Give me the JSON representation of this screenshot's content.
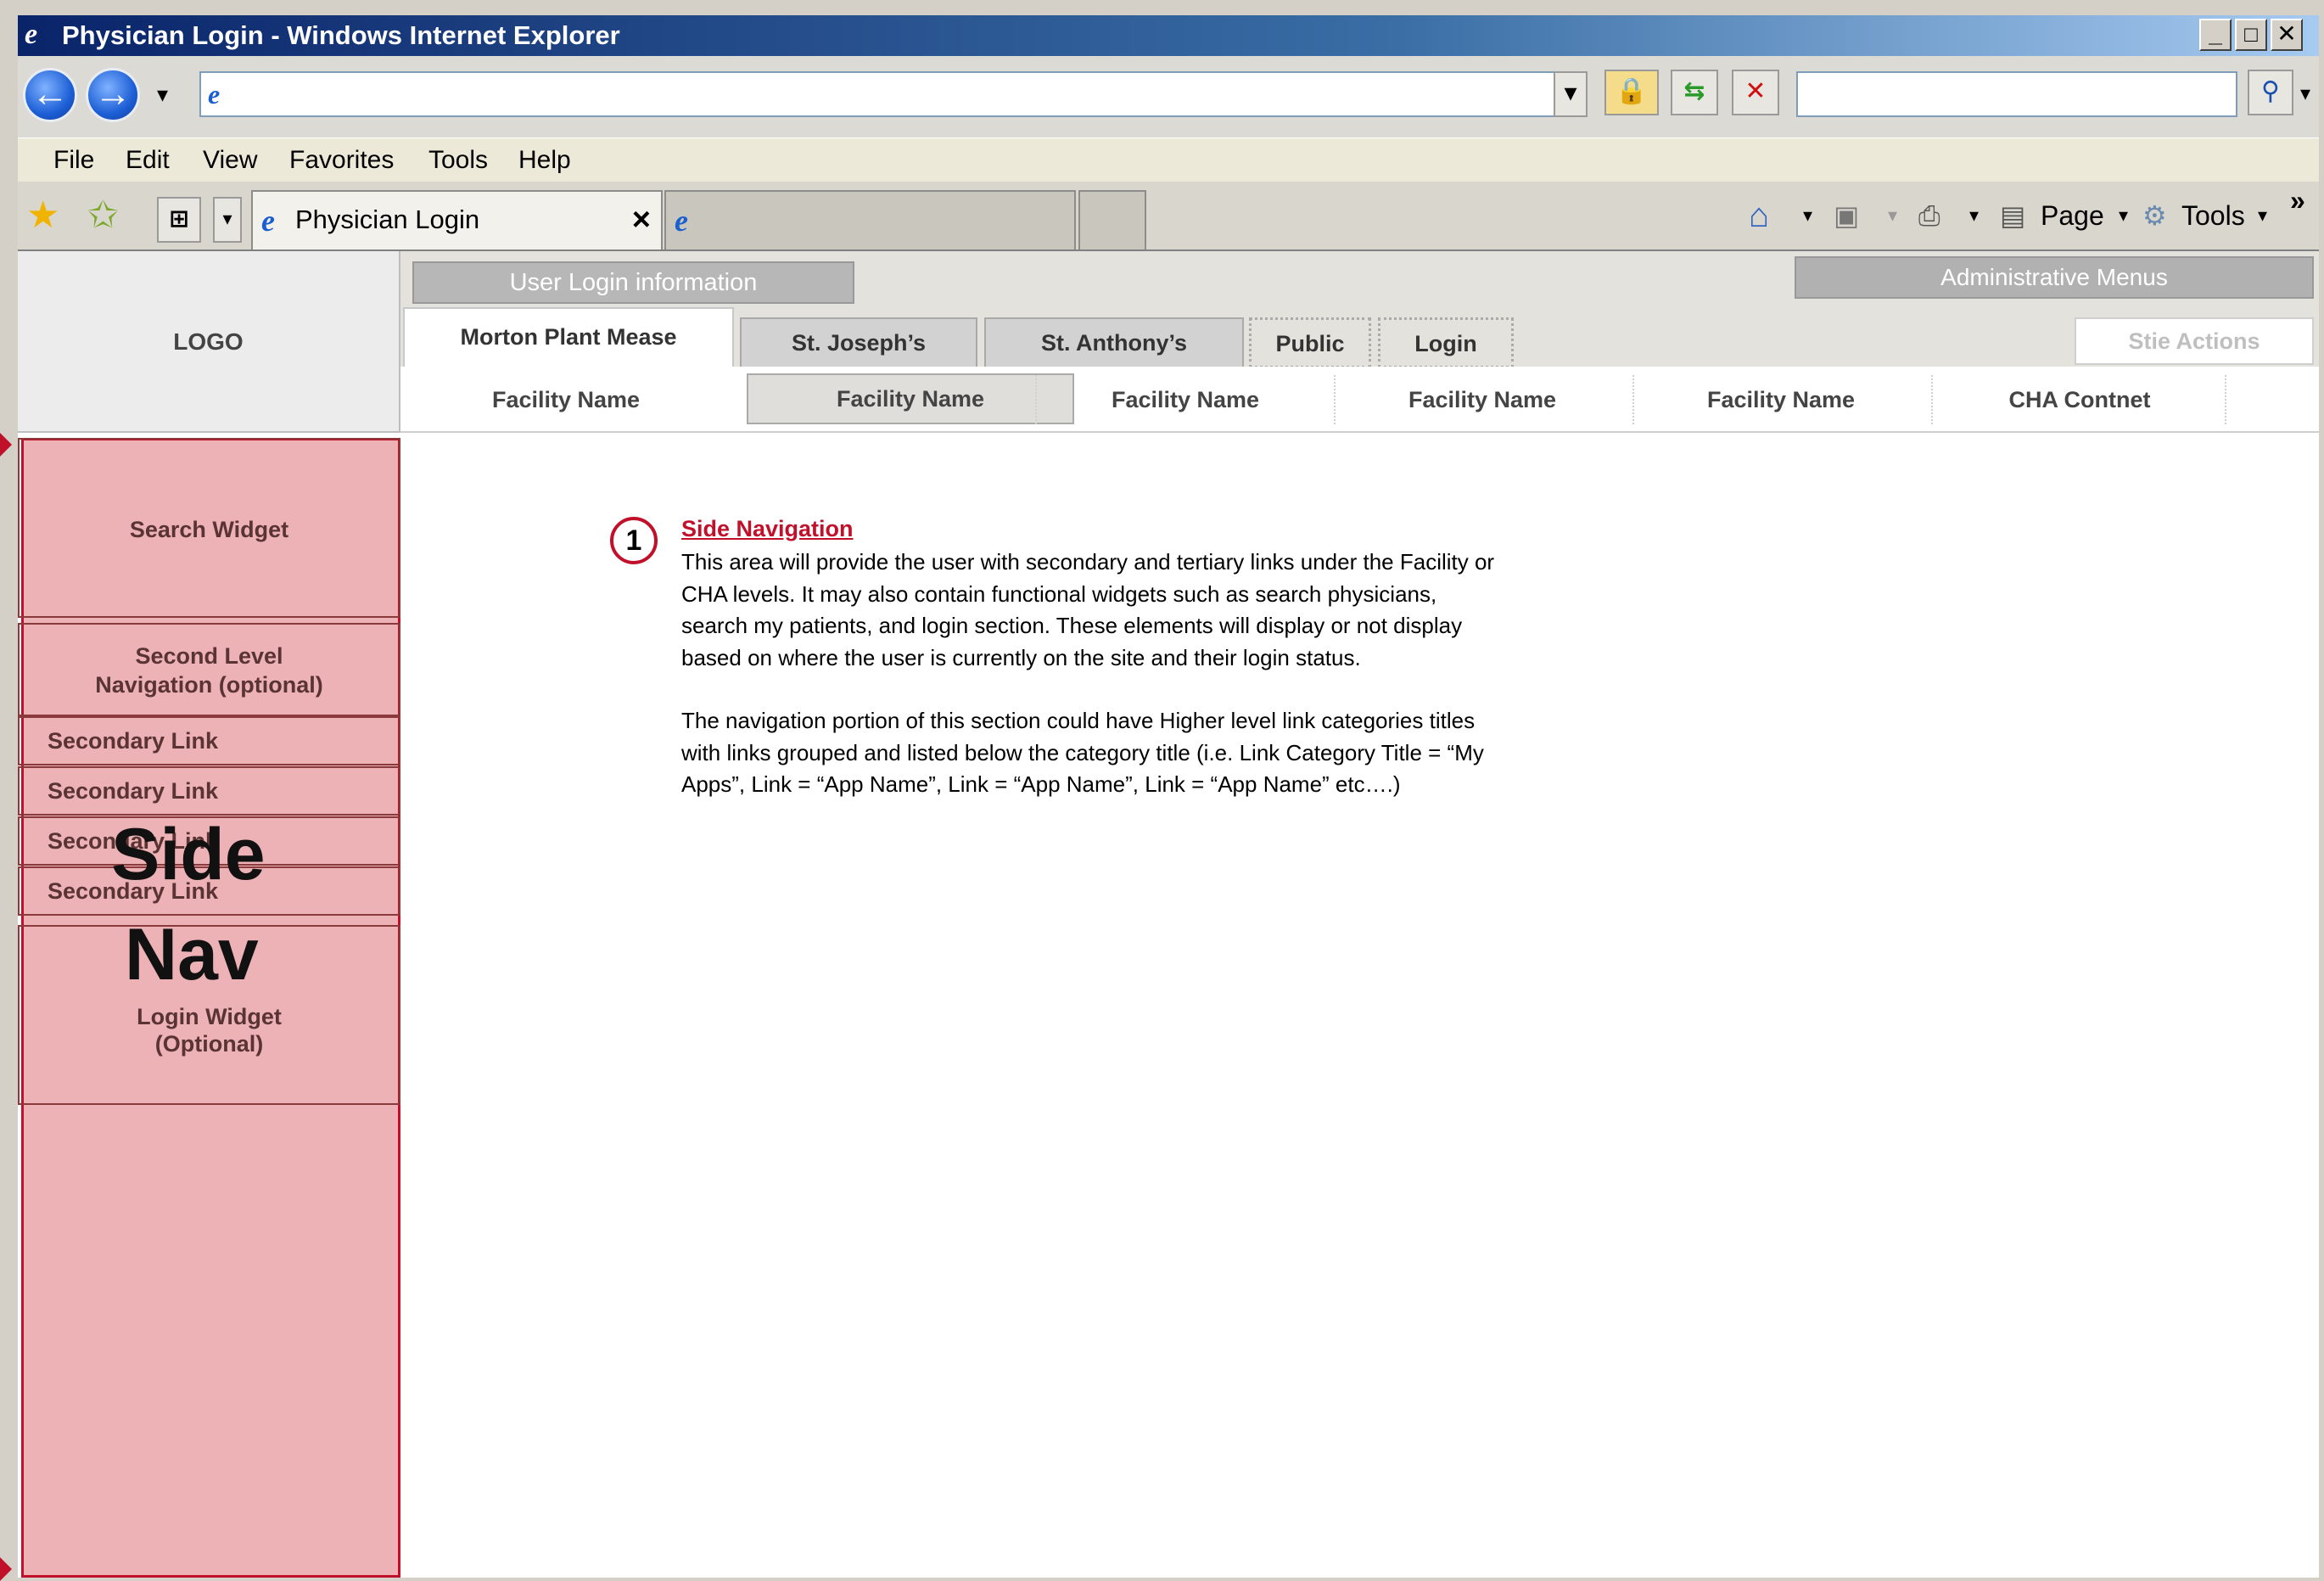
{
  "window": {
    "title": "Physician Login - Windows Internet Explorer",
    "controls": {
      "minimize": "_",
      "maximize": "□",
      "close": "✕"
    }
  },
  "address_bar": {
    "url": "",
    "search_value": "",
    "search_icon": "search-icon"
  },
  "menubar": {
    "items": [
      "File",
      "Edit",
      "View",
      "Favorites",
      "Tools",
      "Help"
    ]
  },
  "tabs": {
    "active_tab": "Physician Login",
    "close_glyph": "×",
    "commands": {
      "page": "Page",
      "tools": "Tools",
      "overflow": "»"
    }
  },
  "page": {
    "logo": "LOGO",
    "user_login_info": "User Login information",
    "admin_menus": "Administrative Menus",
    "site_actions": "Stie Actions",
    "facility_tabs": [
      "Morton Plant Mease",
      "St. Joseph’s",
      "St. Anthony’s",
      "Public",
      "Login"
    ],
    "facility_nav": [
      "Facility Name",
      "Facility Name",
      "Facility Name",
      "Facility Name",
      "Facility Name",
      "CHA Contnet"
    ],
    "side_nav": {
      "search_widget": "Search Widget",
      "second_level_line1": "Second Level",
      "second_level_line2": "Navigation (optional)",
      "links": [
        "Secondary Link",
        "Secondary Link",
        "Secondary Link",
        "Secondary Link"
      ],
      "login_widget_line1": "Login Widget",
      "login_widget_line2": "(Optional)",
      "overlay_line1": "Side",
      "overlay_line2": "Nav"
    },
    "callout": {
      "number": "1",
      "title": "Side Navigation",
      "paragraph1": "This area will provide the user with secondary and tertiary links under the Facility or CHA levels. It may also contain functional widgets such as search physicians, search my patients, and login section. These elements will display or not display based on where the user is currently on the site and their login status.",
      "paragraph2": "The navigation portion of this section could have Higher level link categories titles with links grouped and listed below the category title (i.e. Link Category Title = “My Apps”,  Link = “App Name”, Link = “App Name”, Link = “App Name” etc….)"
    }
  },
  "colors": {
    "sidenav_highlight": "#d6545a",
    "callout_red": "#c0102a",
    "titlebar_start": "#0a246a"
  }
}
